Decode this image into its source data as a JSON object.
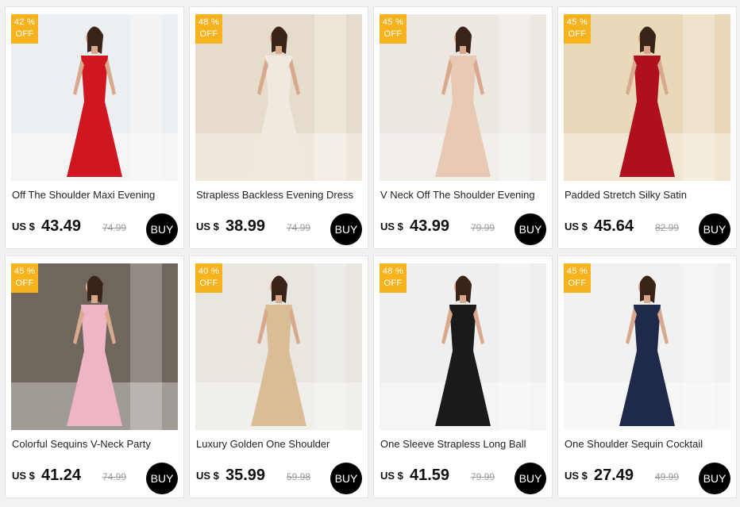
{
  "currency": "US $",
  "buy_label": "BUY",
  "badge_suffix": "OFF",
  "products": [
    {
      "discount": "42 %",
      "title": "Off The Shoulder Maxi Evening",
      "price": "43.49",
      "old_price": "74.99",
      "dress_color": "#d0161e",
      "bg": "#eceff1"
    },
    {
      "discount": "48 %",
      "title": "Strapless Backless Evening Dress",
      "price": "38.99",
      "old_price": "74.99",
      "dress_color": "#efe9df",
      "bg": "#e6dccb"
    },
    {
      "discount": "45 %",
      "title": "V Neck Off The Shoulder Evening",
      "price": "43.99",
      "old_price": "79.99",
      "dress_color": "#e8c9b4",
      "bg": "#ece7e1"
    },
    {
      "discount": "45 %",
      "title": "Padded Stretch Silky Satin",
      "price": "45.64",
      "old_price": "82.99",
      "dress_color": "#b0101e",
      "bg": "#ead9b9"
    },
    {
      "discount": "45 %",
      "title": "Colorful Sequins V-Neck Party",
      "price": "41.24",
      "old_price": "74.99",
      "dress_color": "#f0b5c4",
      "bg": "#6f665d"
    },
    {
      "discount": "40 %",
      "title": "Luxury Golden One Shoulder",
      "price": "35.99",
      "old_price": "59.98",
      "dress_color": "#d9bd97",
      "bg": "#e9e6e0"
    },
    {
      "discount": "48 %",
      "title": "One Sleeve Strapless Long Ball",
      "price": "41.59",
      "old_price": "79.99",
      "dress_color": "#1a1a1a",
      "bg": "#efefef"
    },
    {
      "discount": "45 %",
      "title": "One Shoulder Sequin Cocktail",
      "price": "27.49",
      "old_price": "49.99",
      "dress_color": "#1f2a4a",
      "bg": "#f1f1f1"
    }
  ]
}
